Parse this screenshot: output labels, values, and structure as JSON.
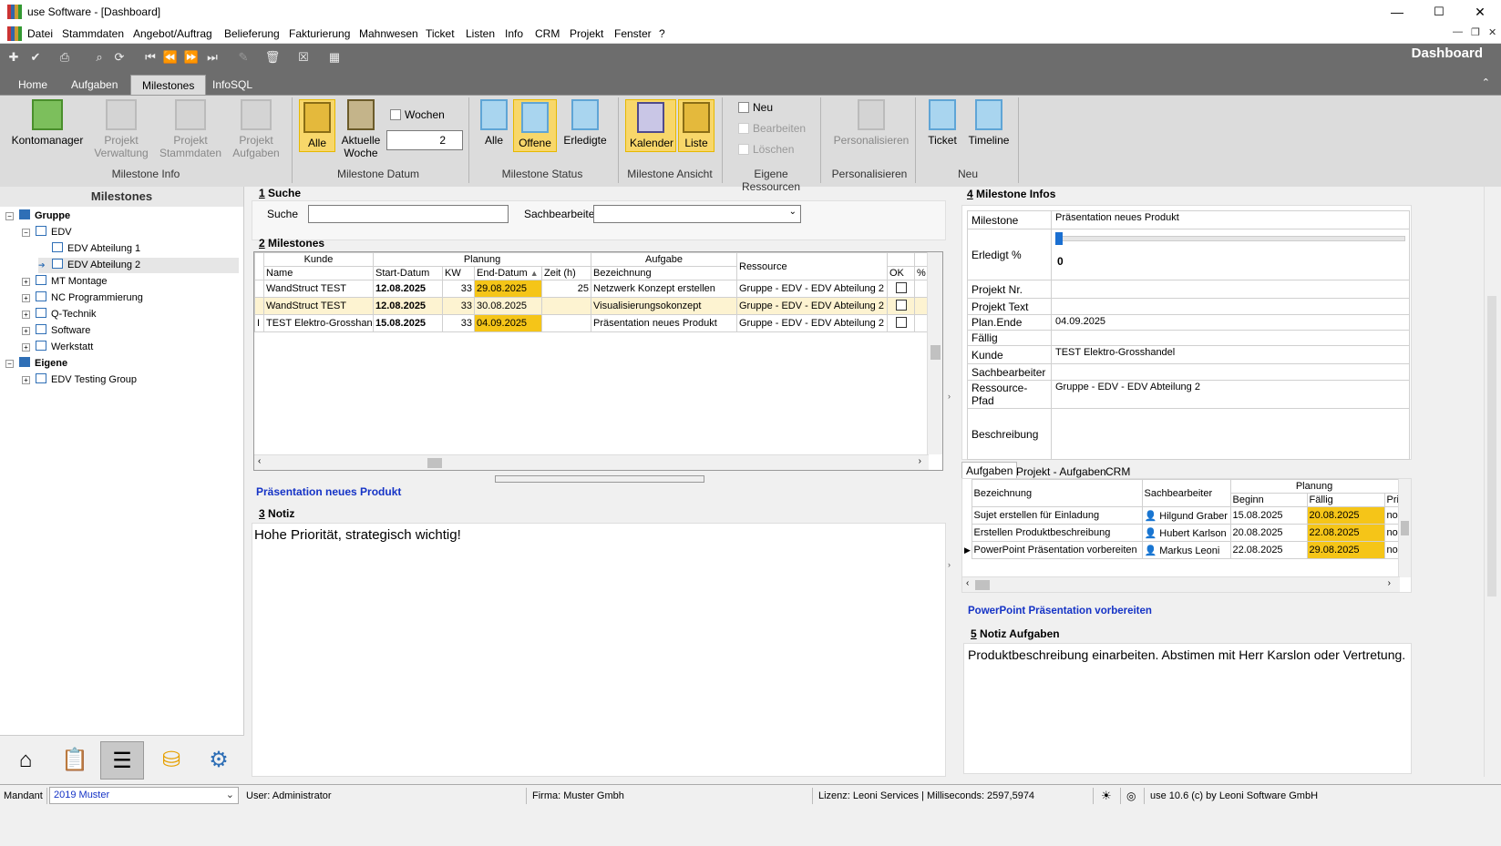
{
  "window": {
    "title": "use Software - [Dashboard]",
    "min": "—",
    "max": "☐",
    "close": "✕"
  },
  "menu": [
    "Datei",
    "Stammdaten",
    "Angebot/Auftrag",
    "Belieferung",
    "Fakturierung",
    "Mahnwesen",
    "Ticket",
    "Listen",
    "Info",
    "CRM",
    "Projekt",
    "Fenster",
    "?"
  ],
  "ribbon": {
    "title": "Dashboard",
    "tabs": [
      "Home",
      "Aufgaben",
      "Milestones",
      "InfoSQL"
    ],
    "active_tab": "Milestones",
    "kontomanager": "Kontomanager",
    "projekt_verwaltung": "Projekt\nVerwaltung",
    "projekt_stammdaten": "Projekt\nStammdaten",
    "projekt_aufgaben": "Projekt\nAufgaben",
    "group_milestone_info": "Milestone Info",
    "alle": "Alle",
    "aktuelle_woche": "Aktuelle\nWoche",
    "wochen": "Wochen",
    "wochen_value": "2",
    "group_milestone_datum": "Milestone Datum",
    "status_alle": "Alle",
    "status_offene": "Offene",
    "status_erledigte": "Erledigte",
    "group_milestone_status": "Milestone Status",
    "kalender": "Kalender",
    "liste": "Liste",
    "group_milestone_ansicht": "Milestone Ansicht",
    "neu": "Neu",
    "bearbeiten": "Bearbeiten",
    "loeschen": "Löschen",
    "group_eigene_ressourcen": "Eigene Ressourcen",
    "personalisieren": "Personalisieren",
    "group_personalisieren": "Personalisieren",
    "ticket": "Ticket",
    "timeline": "Timeline",
    "group_neu": "Neu"
  },
  "left": {
    "header": "Milestones",
    "tree": [
      {
        "label": "Gruppe",
        "level": 0,
        "exp": "−",
        "bold": true,
        "solid": true
      },
      {
        "label": "EDV",
        "level": 1,
        "exp": "−"
      },
      {
        "label": "EDV Abteilung 1",
        "level": 2
      },
      {
        "label": "EDV Abteilung 2",
        "level": 2,
        "selected": true
      },
      {
        "label": "MT Montage",
        "level": 1,
        "exp": "+"
      },
      {
        "label": "NC Programmierung",
        "level": 1,
        "exp": "+"
      },
      {
        "label": "Q-Technik",
        "level": 1,
        "exp": "+"
      },
      {
        "label": "Software",
        "level": 1,
        "exp": "+"
      },
      {
        "label": "Werkstatt",
        "level": 1,
        "exp": "+"
      },
      {
        "label": "Eigene",
        "level": 0,
        "exp": "−",
        "bold": true,
        "solid": true
      },
      {
        "label": "EDV Testing Group",
        "level": 1,
        "exp": "+"
      }
    ]
  },
  "search": {
    "num": "1",
    "title": "Suche",
    "suche_label": "Suche",
    "suche_value": "",
    "sachbearbeiter_label": "Sachbearbeiter",
    "sachbearbeiter_value": ""
  },
  "milestones": {
    "num": "2",
    "title": "Milestones",
    "group_headers": {
      "kunde": "Kunde",
      "planung": "Planung",
      "aufgabe": "Aufgabe",
      "ressource": "Ressource"
    },
    "columns": [
      "Name",
      "Start-Datum",
      "KW",
      "End-Datum",
      "Zeit (h)",
      "Bezeichnung",
      "OK",
      "%"
    ],
    "rows": [
      {
        "name": "WandStruct TEST",
        "start": "12.08.2025",
        "kw": "33",
        "end": "29.08.2025",
        "zeit": "25",
        "bez": "Netzwerk Konzept erstellen",
        "res": "Gruppe - EDV - EDV Abteilung 2"
      },
      {
        "name": "WandStruct TEST",
        "start": "12.08.2025",
        "kw": "33",
        "end": "30.08.2025",
        "zeit": "",
        "bez": "Visualisierungsokonzept",
        "res": "Gruppe - EDV - EDV Abteilung 2"
      },
      {
        "name": "TEST Elektro-Grosshandel",
        "start": "15.08.2025",
        "kw": "33",
        "end": "04.09.2025",
        "zeit": "",
        "bez": "Präsentation neues Produkt",
        "res": "Gruppe - EDV - EDV Abteilung 2"
      }
    ]
  },
  "selected_milestone": "Präsentation neues Produkt",
  "notiz": {
    "num": "3",
    "title": "Notiz",
    "text": "Hohe Priorität, strategisch wichtig!"
  },
  "info": {
    "num": "4",
    "title": "Milestone Infos",
    "rows": [
      {
        "label": "Milestone",
        "value": "Präsentation neues Produkt"
      },
      {
        "label": "Erledigt %",
        "value": "0"
      },
      {
        "label": "Projekt Nr.",
        "value": ""
      },
      {
        "label": "Projekt Text",
        "value": ""
      },
      {
        "label": "Plan.Ende",
        "value": "04.09.2025"
      },
      {
        "label": "Fällig",
        "value": ""
      },
      {
        "label": "Kunde",
        "value": "TEST Elektro-Grosshandel"
      },
      {
        "label": "Sachbearbeiter",
        "value": ""
      },
      {
        "label": "Ressource-Pfad",
        "value": "Gruppe - EDV - EDV Abteilung 2"
      },
      {
        "label": "Beschreibung",
        "value": ""
      }
    ]
  },
  "subtabs": [
    "Aufgaben",
    "Projekt - Aufgaben",
    "CRM"
  ],
  "aufgaben": {
    "headers": {
      "bez": "Bezeichnung",
      "sach": "Sachbearbeiter",
      "planung": "Planung",
      "beginn": "Beginn",
      "faellig": "Fällig",
      "prio": "Pri"
    },
    "rows": [
      {
        "bez": "Sujet erstellen für Einladung",
        "sach": "Hilgund Graber",
        "beginn": "15.08.2025",
        "faellig": "20.08.2025",
        "prio": "nor"
      },
      {
        "bez": "Erstellen Produktbeschreibung",
        "sach": "Hubert Karlson",
        "beginn": "20.08.2025",
        "faellig": "22.08.2025",
        "prio": "nor"
      },
      {
        "bez": "PowerPoint Präsentation vorbereiten",
        "sach": "Markus Leoni",
        "beginn": "22.08.2025",
        "faellig": "29.08.2025",
        "prio": "nor"
      }
    ]
  },
  "selected_aufgabe": "PowerPoint Präsentation vorbereiten",
  "notiz_aufgaben": {
    "num": "5",
    "title": "Notiz Aufgaben",
    "text": "Produktbeschreibung einarbeiten. Abstimen mit Herr Karslon oder Vertretung."
  },
  "status": {
    "mandant_label": "Mandant",
    "mandant_value": "2019 Muster",
    "user": "User: Administrator",
    "firma": "Firma: Muster Gmbh",
    "lizenz": "Lizenz: Leoni Services | Milliseconds: 2597,5974",
    "version": "use 10.6 (c) by Leoni Software GmbH"
  },
  "colors": {
    "accent_yellow": "#f5c518",
    "ribbon_bg": "#6d6d6d",
    "link_blue": "#1533c6",
    "tree_blue": "#2f6fb6"
  }
}
